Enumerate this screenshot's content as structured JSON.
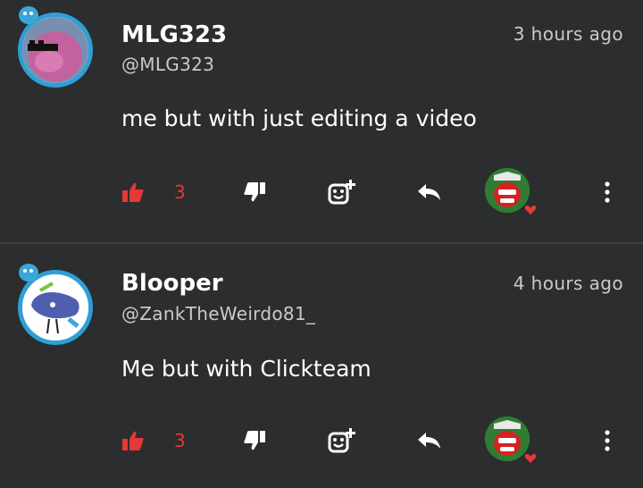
{
  "comments": [
    {
      "name": "MLG323",
      "handle": "@MLG323",
      "time": "3 hours ago",
      "text": "me but with just editing a video",
      "likes": "3"
    },
    {
      "name": "Blooper",
      "handle": "@ZankTheWeirdo81_",
      "time": "4 hours ago",
      "text": "Me but with Clickteam",
      "likes": "3"
    }
  ],
  "colors": {
    "background": "#2b2d2f",
    "accent_ring": "#2f9fd6",
    "like_red": "#e53935",
    "text_muted": "#c9cacb"
  },
  "icons": [
    "thumbs-up-icon",
    "thumbs-down-icon",
    "add-emoji-icon",
    "reply-icon",
    "reactor-avatar",
    "heart-icon",
    "more-vertical-icon"
  ]
}
